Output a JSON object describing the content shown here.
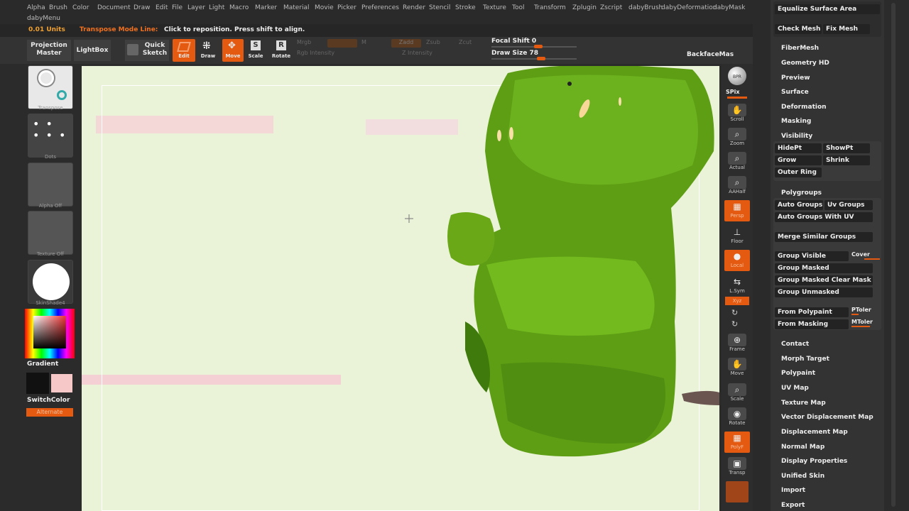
{
  "menu": {
    "items": [
      "Alpha",
      "Brush",
      "Color",
      "Document",
      "Draw",
      "Edit",
      "File",
      "Layer",
      "Light",
      "Macro",
      "Marker",
      "Material",
      "Movie",
      "Picker",
      "Preferences",
      "Render",
      "Stencil",
      "Stroke",
      "Texture",
      "Tool",
      "Transform",
      "Zplugin",
      "Zscript",
      "dabyBrush",
      "dabyDeformation",
      "dabyMask"
    ],
    "second_row": "dabyMenu"
  },
  "status": {
    "units": "0.01 Units",
    "mode": "Transpose Mode Line:",
    "hint": "Click to reposition. Press shift to align."
  },
  "toolbar": {
    "projection_master": "Projection Master",
    "lightbox": "LightBox",
    "quick_sketch": "Quick Sketch",
    "edit": "Edit",
    "draw": "Draw",
    "move": "Move",
    "scale": "Scale",
    "rotate": "Rotate",
    "mrgb": "Mrgb",
    "m": "M",
    "rgb_intensity": "Rgb Intensity",
    "zadd": "Zadd",
    "zsub": "Zsub",
    "zcut": "Zcut",
    "z_intensity": "Z Intensity",
    "focal_shift": "Focal Shift 0",
    "draw_size": "Draw Size 78",
    "backface": "BackfaceMas"
  },
  "left": {
    "transpose": "Transpose",
    "dots": "Dots",
    "alpha": "Alpha Off",
    "texture": "Texture Off",
    "material": "SkinShade4",
    "gradient": "Gradient",
    "switch": "SwitchColor",
    "alternate": "Alternate"
  },
  "shelf": {
    "bpr": "BPR",
    "spix": "SPix",
    "scroll": "Scroll",
    "zoom": "Zoom",
    "actual": "Actual",
    "aahalf": "AAHalf",
    "persp": "Persp",
    "floor": "Floor",
    "local": "Local",
    "lsym": "L.Sym",
    "xyz": "Xyz",
    "frame": "Frame",
    "move": "Move",
    "scale": "Scale",
    "rotate": "Rotate",
    "polyf": "PolyF",
    "transp": "Transp"
  },
  "right": {
    "equalize": "Equalize Surface Area",
    "check_mesh": "Check Mesh",
    "fix_mesh": "Fix Mesh",
    "fibermesh": "FiberMesh",
    "geometry_hd": "Geometry HD",
    "preview": "Preview",
    "surface": "Surface",
    "deformation": "Deformation",
    "masking": "Masking",
    "visibility": "Visibility",
    "hidept": "HidePt",
    "showpt": "ShowPt",
    "grow": "Grow",
    "shrink": "Shrink",
    "outer_ring": "Outer Ring",
    "polygroups": "Polygroups",
    "auto_groups": "Auto Groups",
    "uv_groups": "Uv Groups",
    "auto_groups_uv": "Auto Groups With UV",
    "merge_similar": "Merge Similar Groups",
    "group_visible": "Group Visible",
    "coverage": "Cover",
    "group_masked": "Group Masked",
    "group_masked_clear": "Group Masked Clear Mask",
    "group_unmasked": "Group Unmasked",
    "from_polypaint": "From Polypaint",
    "ptoler": "PToler",
    "from_masking": "From Masking",
    "mtoler": "MToler",
    "contact": "Contact",
    "morph_target": "Morph Target",
    "polypaint": "Polypaint",
    "uv_map": "UV Map",
    "texture_map": "Texture Map",
    "vector_disp": "Vector Displacement Map",
    "disp_map": "Displacement Map",
    "normal_map": "Normal Map",
    "display_props": "Display Properties",
    "unified_skin": "Unified Skin",
    "import": "Import",
    "export": "Export"
  },
  "colors": {
    "accent": "#e35a10",
    "model_green": "#5e9e14",
    "canvas_bg": "#eaf2d8"
  }
}
